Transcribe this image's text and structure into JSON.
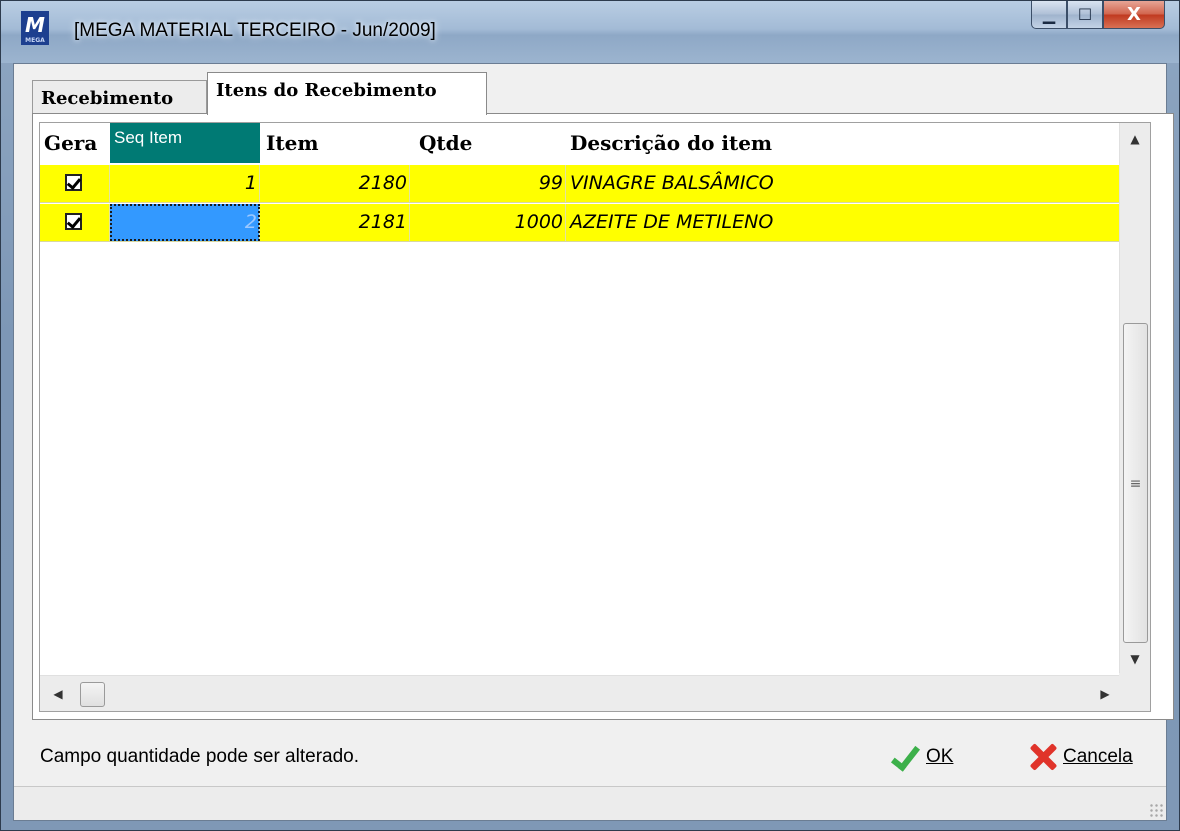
{
  "window": {
    "title": "[MEGA MATERIAL TERCEIRO - Jun/2009]",
    "icon_letters": "M",
    "icon_subtext": "MEGA",
    "min_symbol": "▁",
    "max_symbol": "☐",
    "close_symbol": "X"
  },
  "tabs": [
    {
      "label": "Recebimento",
      "active": false
    },
    {
      "label": "Itens do Recebimento",
      "active": true
    }
  ],
  "grid": {
    "columns": [
      "Gera",
      "Seq Item",
      "Item",
      "Qtde",
      "Descrição do item"
    ],
    "selected_column": "Seq Item",
    "rows": [
      {
        "gera": true,
        "seq": "1",
        "item": "2180",
        "qtde": "99",
        "descricao": "VINAGRE BALSÂMICO"
      },
      {
        "gera": true,
        "seq": "2",
        "item": "2181",
        "qtde": "1000",
        "descricao": "AZEITE DE METILENO"
      }
    ],
    "row_color": "#ffff00",
    "focused_cell": {
      "row": 2,
      "column": "Seq Item"
    }
  },
  "scroll": {
    "up": "▲",
    "down": "▼",
    "left": "◀",
    "right": "▶",
    "thumb_grip": "≡"
  },
  "footer": {
    "message": "Campo quantidade pode ser alterado.",
    "ok_label": "OK",
    "cancel_label": "Cancela"
  },
  "colors": {
    "header_selected": "#007a74",
    "focus_cell": "#3399ff",
    "ok_icon": "#3cb04a",
    "cancel_icon": "#e0332a"
  },
  "icons": [
    "app-icon",
    "minimize-icon",
    "maximize-icon",
    "close-icon",
    "checkbox-icon",
    "check-icon",
    "x-icon",
    "size-grip-icon"
  ]
}
